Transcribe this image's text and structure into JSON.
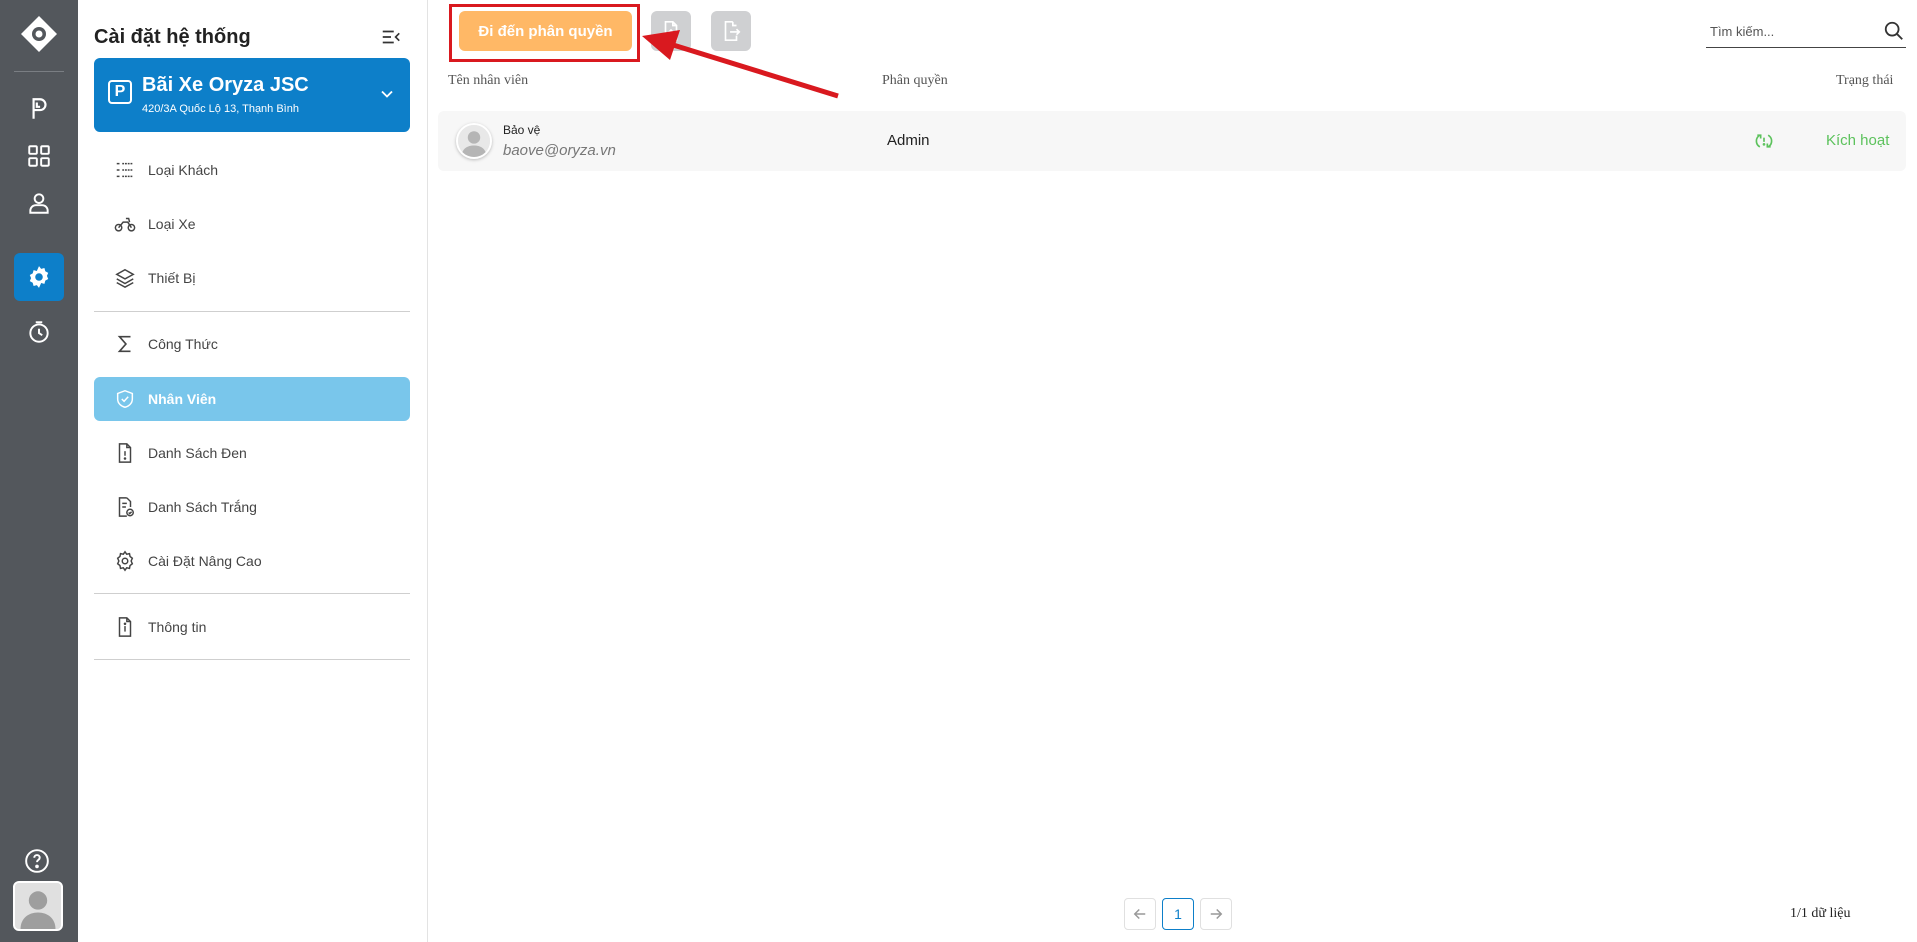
{
  "sidebar_panel": {
    "title": "Cài đặt hệ thống",
    "parking_lot": {
      "name": "Bãi Xe Oryza JSC",
      "address": "420/3A Quốc Lộ 13, Thạnh Bình",
      "badge": "P"
    },
    "menu": [
      {
        "label": "Loại Khách",
        "icon": "customer-type-icon",
        "active": false
      },
      {
        "label": "Loại Xe",
        "icon": "motorbike-icon",
        "active": false
      },
      {
        "label": "Thiết Bị",
        "icon": "layers-icon",
        "active": false
      },
      {
        "label": "Công Thức",
        "icon": "sigma-icon",
        "active": false
      },
      {
        "label": "Nhân Viên",
        "icon": "shield-check-icon",
        "active": true
      },
      {
        "label": "Danh Sách Đen",
        "icon": "file-alert-icon",
        "active": false
      },
      {
        "label": "Danh Sách Trắng",
        "icon": "file-check-icon",
        "active": false
      },
      {
        "label": "Cài Đặt Nâng Cao",
        "icon": "gear-icon",
        "active": false
      },
      {
        "label": "Thông tin",
        "icon": "file-info-icon",
        "active": false
      }
    ]
  },
  "toolbar": {
    "permission_button": "Đi đến phân quyền",
    "search_placeholder": "Tìm kiếm..."
  },
  "table": {
    "headers": {
      "name": "Tên nhân viên",
      "role": "Phân quyền",
      "status": "Trạng thái"
    },
    "rows": [
      {
        "name": "Bảo vệ",
        "email": "baove@oryza.vn",
        "role": "Admin",
        "status": "Kích hoạt"
      }
    ]
  },
  "pagination": {
    "current_page": "1",
    "summary": "1/1 dữ liệu"
  },
  "colors": {
    "accent": "#0d7fc9",
    "active_menu": "#79c6eb",
    "primary_button": "#ffb866",
    "annotation_red": "#d9191f",
    "status_active": "#5cc25c",
    "rail": "#53575c"
  }
}
